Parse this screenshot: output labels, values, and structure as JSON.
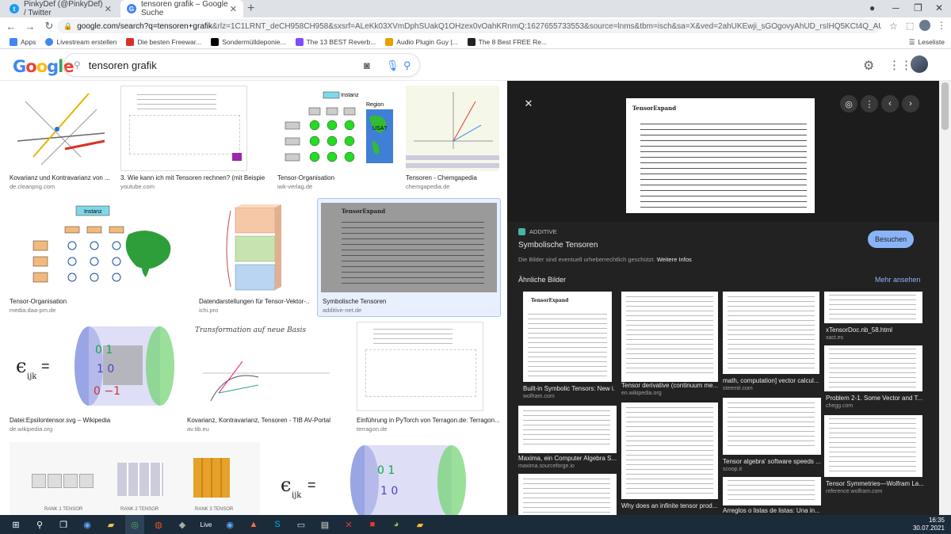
{
  "browser": {
    "tabs": [
      {
        "title": "PinkyDef (@PinkyDef) / Twitter",
        "icon": "twitter-icon"
      },
      {
        "title": "tensoren grafik – Google Suche",
        "icon": "google-icon"
      }
    ],
    "url_main": "google.com/search?q=tensoren+grafik",
    "url_rest": "&rlz=1C1LRNT_deCH958CH958&sxsrf=ALeKk03XVmDphSUakQ1OHzex0vOahKRnmQ:1627655733553&source=lnms&tbm=isch&sa=X&ved=2ahUKEwji_sGOgovyAhUD_rsIHQ5KCt4Q_AUoAXoECAEQAw&biw=1920&bih=93...",
    "bookmarks": [
      "Apps",
      "Livestream erstellen",
      "Die besten Freewar...",
      "Sondermülldeponie...",
      "The 13 BEST Reverb...",
      "Audio Plugin Guy |...",
      "The 8 Best FREE Re..."
    ],
    "reading_list": "Leseliste"
  },
  "google": {
    "logo": "Google",
    "query": "tensoren grafik"
  },
  "results": [
    {
      "caption": "Kovarianz und Kontravarianz von ...",
      "source": "de.cleanpng.com"
    },
    {
      "caption": "3. Wie kann ich mit Tensoren rechnen? (mit Beispie...",
      "source": "youtube.com"
    },
    {
      "caption": "Tensor-Organisation",
      "source": "iwk-verlag.de"
    },
    {
      "caption": "Tensoren - Chemgapedia",
      "source": "chemgapedia.de"
    },
    {
      "caption": "Tensor-Organisation",
      "source": "media.daa-pm.de"
    },
    {
      "caption": "Datendarstellungen für Tensor-Vektor-...",
      "source": "ichi.pro"
    },
    {
      "caption": "Symbolische Tensoren",
      "source": "additive-net.de"
    },
    {
      "caption": "Datei:Epsilontensor.svg – Wikipedia",
      "source": "de.wikipedia.org"
    },
    {
      "caption": "Kovarianz, Kontravarianz, Tensoren - TIB AV-Portal",
      "source": "av.tib.eu"
    },
    {
      "caption": "Einführung in PyTorch von Terragon.de: Terragon...",
      "source": "terragon.de"
    }
  ],
  "thumb_text": {
    "instanz": "Instanz",
    "region": "Region",
    "usa": "USA?",
    "epsilon": "ϵ",
    "ijk": "ijk",
    "equals": "=",
    "transform": "Transformation auf neue Basis",
    "rank1": "RANK 1 TENSOR",
    "rank2": "RANK 2 TENSOR",
    "rank3": "RANK 3 TENSOR",
    "tensorexpand": "TensorExpand"
  },
  "viewer": {
    "site": "ADDITIVE",
    "title": "Symbolische Tensoren",
    "copyright": "Die Bilder sind eventuell urheberrechtlich geschützt.",
    "more_info": "Weitere Infos",
    "visit": "Besuchen",
    "similar_heading": "Ähnliche Bilder",
    "see_more": "Mehr ansehen",
    "similar": [
      {
        "caption": "Built-in Symbolic Tensors: New i...",
        "source": "wolfram.com"
      },
      {
        "caption": "Tensor derivative (continuum me...",
        "source": "en.wikipedia.org"
      },
      {
        "caption": "math, computation] vector calcul...",
        "source": "steemit.com"
      },
      {
        "caption": "xTensorDoc.nb_58.html",
        "source": "xact.es"
      },
      {
        "caption": "Problem 2-1. Some Vector and T...",
        "source": "chegg.com"
      },
      {
        "caption": "Maxima, ein Computer Algebra S...",
        "source": "maxima.sourceforge.io"
      },
      {
        "caption": "Tensor algebra' software speeds ...",
        "source": "scoop.it"
      },
      {
        "caption": "Tensor Symmetries—Wolfram La...",
        "source": "reference.wolfram.com"
      },
      {
        "caption": "Why does an infinite tensor prod...",
        "source": ""
      },
      {
        "caption": "Arreglos o listas de listas: Una in...",
        "source": ""
      }
    ]
  },
  "taskbar": {
    "time": "16:35",
    "date": "30.07.2021"
  },
  "colors": {
    "accent": "#1a73e8",
    "visit": "#8ab4f8",
    "taskbar": "#1c2b3a"
  }
}
